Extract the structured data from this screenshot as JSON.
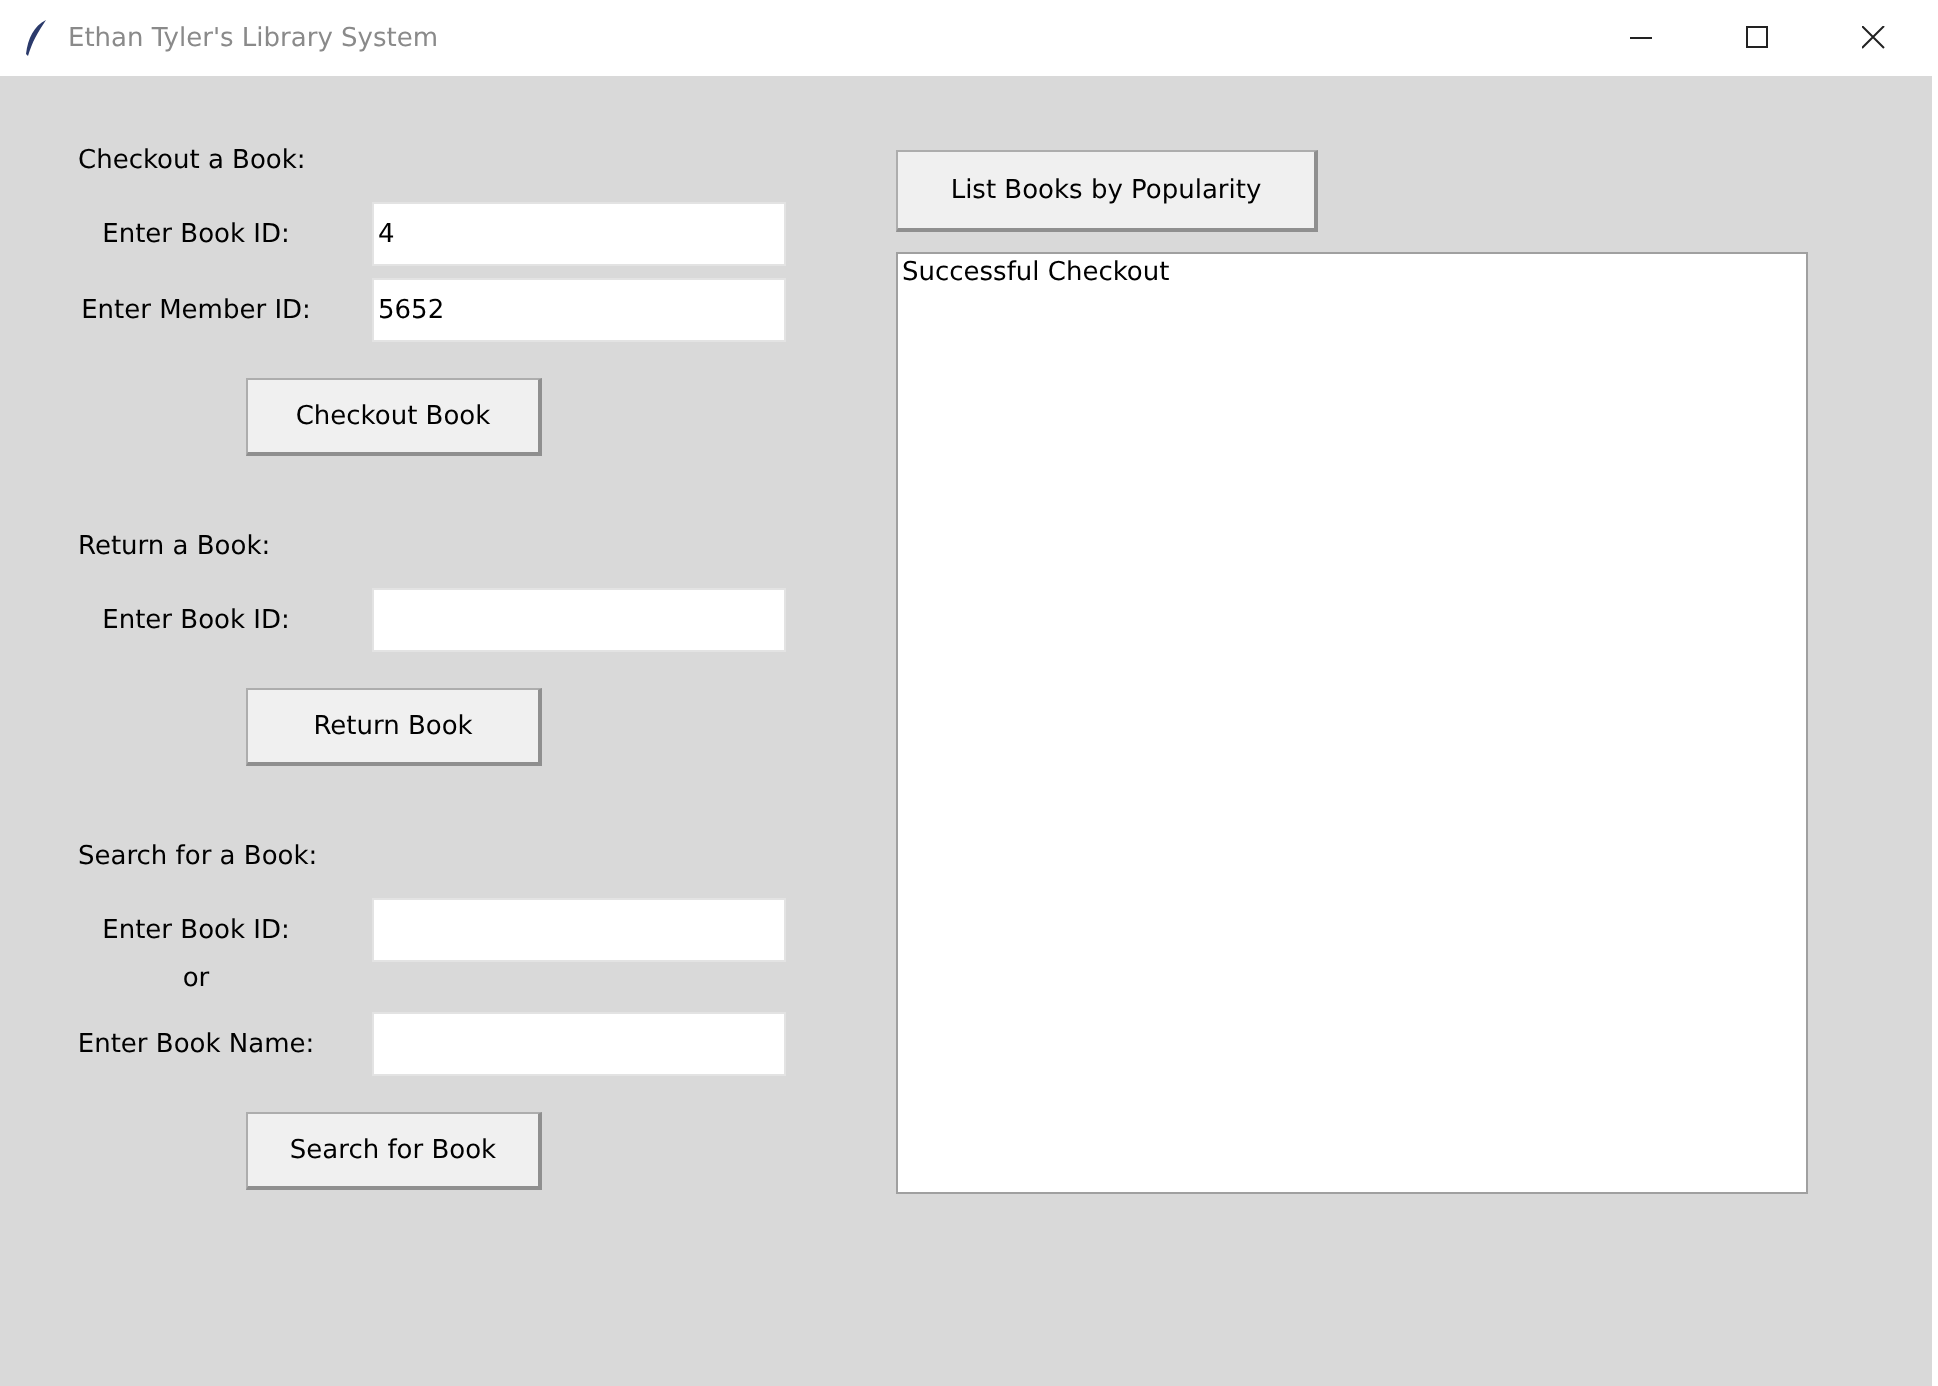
{
  "window": {
    "title": "Ethan Tyler's Library System"
  },
  "left": [
    {
      "kind": "heading",
      "text": "Checkout a Book:"
    },
    {
      "kind": "field",
      "label": "Enter Book ID:",
      "value": "4"
    },
    {
      "kind": "field",
      "label": "Enter Member ID:",
      "value": "5652"
    },
    {
      "kind": "button",
      "text": "Checkout Book"
    },
    {
      "kind": "heading",
      "text": "Return a Book:"
    },
    {
      "kind": "field",
      "label": "Enter Book ID:"
    },
    {
      "kind": "button",
      "text": "Return Book"
    },
    {
      "kind": "heading",
      "text": "Search for a Book:"
    },
    {
      "kind": "field",
      "label": "Enter Book ID:"
    },
    {
      "kind": "or",
      "text": "or"
    },
    {
      "kind": "field",
      "label": "Enter Book Name:"
    },
    {
      "kind": "button",
      "text": "Search for Book"
    }
  ],
  "right": {
    "button": "List Books by Popularity",
    "output": "Successful Checkout"
  }
}
